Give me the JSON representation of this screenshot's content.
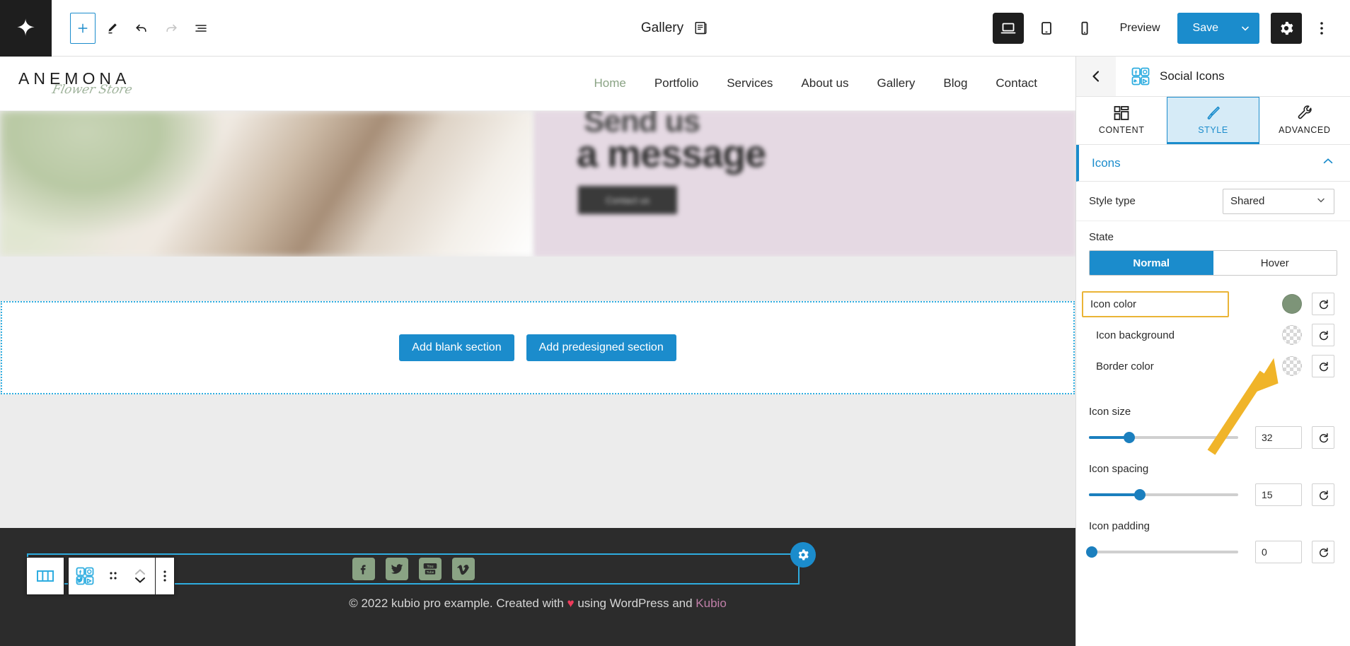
{
  "topbar": {
    "logo_icon": "kubio-logo-icon",
    "add_block_icon": "plus-icon",
    "edit_icon": "pencil-icon",
    "undo_icon": "undo-arrow-icon",
    "redo_icon": "redo-arrow-icon",
    "list_view_icon": "list-view-icon",
    "document_title": "Gallery",
    "document_icon": "page-document-icon",
    "devices": [
      {
        "name": "desktop",
        "icon": "desktop-icon",
        "active": true
      },
      {
        "name": "tablet",
        "icon": "tablet-icon",
        "active": false
      },
      {
        "name": "mobile",
        "icon": "mobile-icon",
        "active": false
      }
    ],
    "preview_label": "Preview",
    "save_label": "Save",
    "save_caret_icon": "chevron-down-icon",
    "settings_icon": "gear-icon",
    "more_icon": "kebab-menu-icon",
    "accent_blue": "#1b8ccc",
    "dark": "#1e1e1e"
  },
  "site": {
    "brand_name": "ANEMONA",
    "brand_tagline": "Flower Store",
    "brand_tagline_color": "#9fb39b",
    "nav": [
      {
        "label": "Home",
        "active": true
      },
      {
        "label": "Portfolio",
        "active": false
      },
      {
        "label": "Services",
        "active": false
      },
      {
        "label": "About us",
        "active": false
      },
      {
        "label": "Gallery",
        "active": false
      },
      {
        "label": "Blog",
        "active": false
      },
      {
        "label": "Contact",
        "active": false
      }
    ],
    "hero": {
      "line1": "Send us",
      "line2": "a message",
      "cta_label": "Contact us",
      "bg_color": "#e5d9e3"
    },
    "footer": {
      "social": [
        {
          "name": "facebook",
          "icon": "facebook-icon"
        },
        {
          "name": "twitter",
          "icon": "twitter-icon"
        },
        {
          "name": "youtube",
          "icon": "youtube-icon"
        },
        {
          "name": "vimeo",
          "icon": "vimeo-icon"
        }
      ],
      "social_color": "#8aa384",
      "copyright_prefix": "© 2022 kubio pro example. Created with ",
      "copyright_heart": "♥",
      "copyright_middle": " using WordPress and ",
      "copyright_link": "Kubio",
      "link_color": "#c07fa8"
    }
  },
  "canvas": {
    "add_blank_label": "Add blank section",
    "add_predesigned_label": "Add predesigned section",
    "block_toolbar": {
      "parent_icon": "columns-block-icon",
      "block_icon": "social-icons-block-icon",
      "drag_icon": "drag-handle-icon",
      "move_up_icon": "chevron-up-icon",
      "move_down_icon": "chevron-down-icon",
      "options_icon": "kebab-menu-icon"
    },
    "overlay_settings_icon": "gear-icon"
  },
  "panel": {
    "back_icon": "chevron-left-icon",
    "block_icon": "social-icons-block-icon",
    "title": "Social Icons",
    "tabs": [
      {
        "label": "CONTENT",
        "icon": "layout-grid-icon",
        "active": false
      },
      {
        "label": "STYLE",
        "icon": "paintbrush-icon",
        "active": true
      },
      {
        "label": "ADVANCED",
        "icon": "wrench-icon",
        "active": false
      }
    ],
    "section": {
      "title": "Icons",
      "collapse_icon": "chevron-up-icon",
      "style_type": {
        "label": "Style type",
        "value": "Shared",
        "chevron_icon": "chevron-down-icon"
      },
      "state": {
        "label": "State",
        "options": [
          {
            "label": "Normal",
            "active": true
          },
          {
            "label": "Hover",
            "active": false
          }
        ]
      },
      "colors": [
        {
          "label": "Icon color",
          "value": "#7d9478",
          "transparent": false,
          "highlighted": true,
          "reset_icon": "reset-icon"
        },
        {
          "label": "Icon background",
          "value": "transparent",
          "transparent": true,
          "highlighted": false,
          "reset_icon": "reset-icon"
        },
        {
          "label": "Border color",
          "value": "transparent",
          "transparent": true,
          "highlighted": false,
          "reset_icon": "reset-icon"
        }
      ],
      "sliders": [
        {
          "label": "Icon size",
          "value": "32",
          "percent": 27,
          "reset_icon": "reset-icon"
        },
        {
          "label": "Icon spacing",
          "value": "15",
          "percent": 34,
          "reset_icon": "reset-icon"
        },
        {
          "label": "Icon padding",
          "value": "0",
          "percent": 2,
          "reset_icon": "reset-icon"
        }
      ]
    }
  },
  "annotation": {
    "arrow_icon": "pointer-arrow-annotation",
    "color": "#f0b429"
  }
}
